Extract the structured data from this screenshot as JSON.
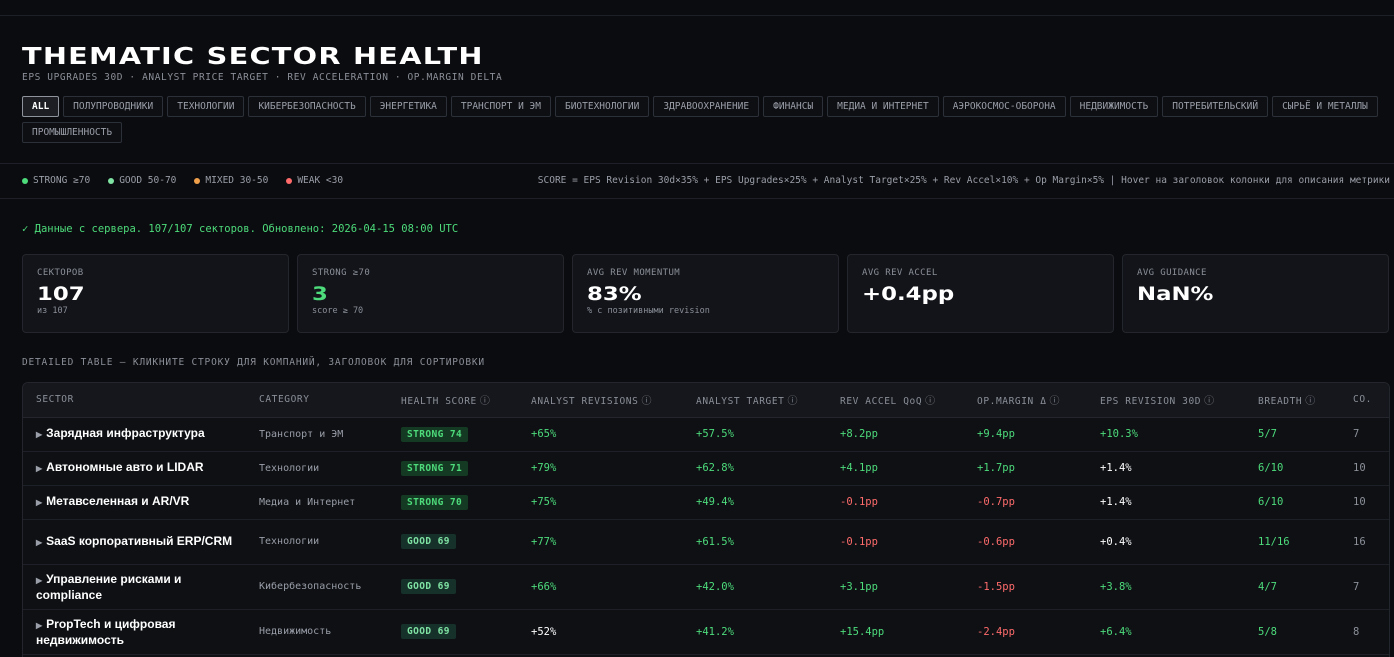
{
  "header": {
    "title": "THEMATIC SECTOR HEALTH",
    "subtitle": "EPS UPGRADES 30D · ANALYST PRICE TARGET · REV ACCELERATION · OP.MARGIN DELTA"
  },
  "filters": [
    "ALL",
    "ПОЛУПРОВОДНИКИ",
    "ТЕХНОЛОГИИ",
    "КИБЕРБЕЗОПАСНОСТЬ",
    "ЭНЕРГЕТИКА",
    "ТРАНСПОРТ И ЭМ",
    "БИОТЕХНОЛОГИИ",
    "ЗДРАВООХРАНЕНИЕ",
    "ФИНАНСЫ",
    "МЕДИА И ИНТЕРНЕТ",
    "АЭРОКОСМОС-ОБОРОНА",
    "НЕДВИЖИМОСТЬ",
    "ПОТРЕБИТЕЛЬСКИЙ",
    "СЫРЬЁ И МЕТАЛЛЫ",
    "ПРОМЫШЛЕННОСТЬ"
  ],
  "legend": {
    "items": [
      {
        "label": "STRONG ≥70",
        "color": "#4ddb7b"
      },
      {
        "label": "GOOD 50-70",
        "color": "#7fe3a3"
      },
      {
        "label": "MIXED 30-50",
        "color": "#f0a04b"
      },
      {
        "label": "WEAK <30",
        "color": "#ff6b6b"
      }
    ],
    "formula": "SCORE = EPS Revision 30d×35% + EPS Upgrades×25% + Analyst Target×25% + Rev Accel×10% + Op Margin×5%  |  Hover на заголовок колонки для описания метрики"
  },
  "status": "✓ Данные с сервера. 107/107 секторов. Обновлено: 2026-04-15 08:00 UTC",
  "cards": [
    {
      "label": "СЕКТОРОВ",
      "value": "107",
      "sub": "из 107",
      "green": false
    },
    {
      "label": "STRONG ≥70",
      "value": "3",
      "sub": "score ≥ 70",
      "green": true
    },
    {
      "label": "AVG REV MOMENTUM",
      "value": "83%",
      "sub": "% с позитивными revision",
      "green": false
    },
    {
      "label": "AVG REV ACCEL",
      "value": "+0.4pp",
      "sub": "",
      "green": false
    },
    {
      "label": "AVG GUIDANCE",
      "value": "NaN%",
      "sub": "",
      "green": false
    }
  ],
  "table": {
    "section_title": "DETAILED TABLE — КЛИКНИТЕ СТРОКУ ДЛЯ КОМПАНИЙ, ЗАГОЛОВОК ДЛЯ СОРТИРОВКИ",
    "columns": [
      {
        "label": "SECTOR",
        "info": false
      },
      {
        "label": "CATEGORY",
        "info": false
      },
      {
        "label": "HEALTH SCORE",
        "info": true
      },
      {
        "label": "ANALYST REVISIONS",
        "info": true
      },
      {
        "label": "ANALYST TARGET",
        "info": true
      },
      {
        "label": "REV ACCEL QoQ",
        "info": true
      },
      {
        "label": "OP.MARGIN Δ",
        "info": true
      },
      {
        "label": "EPS REVISION 30D",
        "info": true
      },
      {
        "label": "BREADTH",
        "info": true
      },
      {
        "label": "CO.",
        "info": false
      }
    ],
    "info_icon": "ⓘ",
    "caret": "▶",
    "rows": [
      {
        "sector": "Зарядная инфраструктура",
        "category": "Транспорт и ЭМ",
        "badge": "STRONG 74",
        "tier": "strong",
        "revisions": "+65%",
        "rev_c": "pos",
        "target": "+57.5%",
        "target_c": "pos",
        "accel": "+8.2pp",
        "accel_c": "pos",
        "margin": "+9.4pp",
        "margin_c": "pos",
        "eps": "+10.3%",
        "eps_c": "pos",
        "breadth": "5/7",
        "breadth_c": "pos",
        "co": "7",
        "tall": false
      },
      {
        "sector": "Автономные авто и LIDAR",
        "category": "Технологии",
        "badge": "STRONG 71",
        "tier": "strong",
        "revisions": "+79%",
        "rev_c": "pos",
        "target": "+62.8%",
        "target_c": "pos",
        "accel": "+4.1pp",
        "accel_c": "pos",
        "margin": "+1.7pp",
        "margin_c": "pos",
        "eps": "+1.4%",
        "eps_c": "neu",
        "breadth": "6/10",
        "breadth_c": "pos",
        "co": "10",
        "tall": false
      },
      {
        "sector": "Метавселенная и AR/VR",
        "category": "Медиа и Интернет",
        "badge": "STRONG 70",
        "tier": "strong",
        "revisions": "+75%",
        "rev_c": "pos",
        "target": "+49.4%",
        "target_c": "pos",
        "accel": "-0.1pp",
        "accel_c": "neg",
        "margin": "-0.7pp",
        "margin_c": "neg",
        "eps": "+1.4%",
        "eps_c": "neu",
        "breadth": "6/10",
        "breadth_c": "pos",
        "co": "10",
        "tall": false
      },
      {
        "sector": "SaaS корпоративный ERP/CRM",
        "category": "Технологии",
        "badge": "GOOD 69",
        "tier": "good",
        "revisions": "+77%",
        "rev_c": "pos",
        "target": "+61.5%",
        "target_c": "pos",
        "accel": "-0.1pp",
        "accel_c": "neg",
        "margin": "-0.6pp",
        "margin_c": "neg",
        "eps": "+0.4%",
        "eps_c": "neu",
        "breadth": "11/16",
        "breadth_c": "pos",
        "co": "16",
        "tall": true
      },
      {
        "sector": "Управление рисками и compliance",
        "category": "Кибербезопасность",
        "badge": "GOOD 69",
        "tier": "good",
        "revisions": "+66%",
        "rev_c": "pos",
        "target": "+42.0%",
        "target_c": "pos",
        "accel": "+3.1pp",
        "accel_c": "pos",
        "margin": "-1.5pp",
        "margin_c": "neg",
        "eps": "+3.8%",
        "eps_c": "pos",
        "breadth": "4/7",
        "breadth_c": "pos",
        "co": "7",
        "tall": true
      },
      {
        "sector": "PropTech и цифровая недвижимость",
        "category": "Недвижимость",
        "badge": "GOOD 69",
        "tier": "good",
        "revisions": "+52%",
        "rev_c": "neu",
        "target": "+41.2%",
        "target_c": "pos",
        "accel": "+15.4pp",
        "accel_c": "pos",
        "margin": "-2.4pp",
        "margin_c": "neg",
        "eps": "+6.4%",
        "eps_c": "pos",
        "breadth": "5/8",
        "breadth_c": "pos",
        "co": "8",
        "tall": true
      }
    ]
  }
}
